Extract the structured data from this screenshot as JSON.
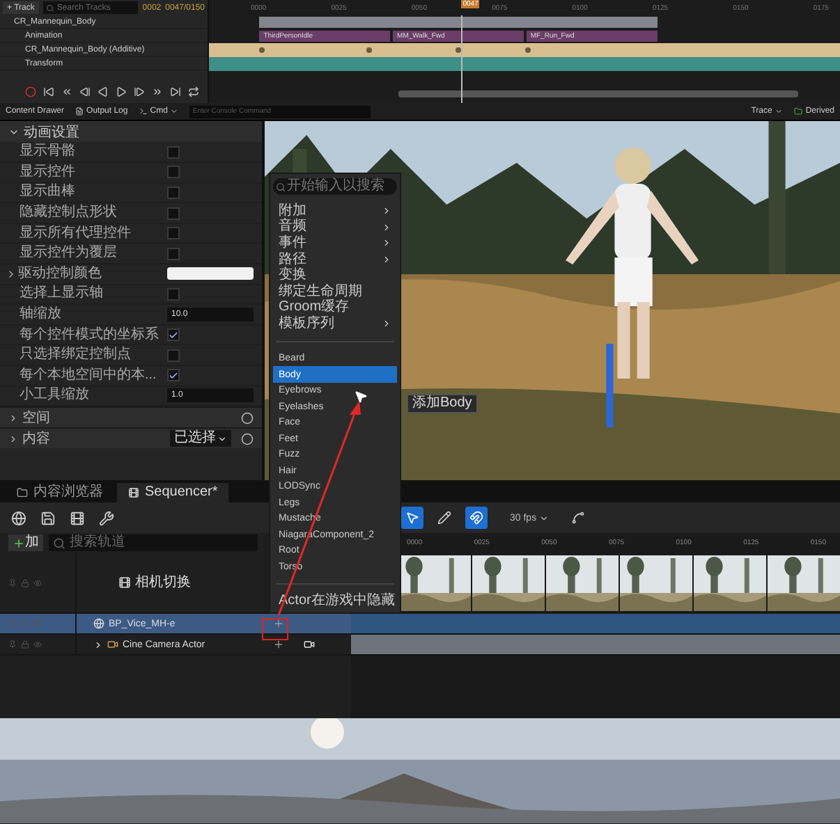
{
  "top_sequencer": {
    "add_track": "+ Track",
    "search": {
      "placeholder": "Search Tracks"
    },
    "frame_start": "0002",
    "frame_end": "0047/0150",
    "tracks": [
      {
        "label": "CR_Mannequin_Body",
        "children": [
          {
            "label": "Animation"
          },
          {
            "label": "CR_Mannequin_Body (Additive)"
          },
          {
            "label": "Transform"
          }
        ]
      }
    ],
    "ticks": [
      "0000",
      "0025",
      "0050",
      "0075",
      "0100",
      "0125",
      "0150",
      "0175"
    ],
    "playhead": "0047",
    "sections": [
      "ThirdPersonIdle",
      "MM_Walk_Fwd",
      "MF_Run_Fwd"
    ]
  },
  "bottom_bar": {
    "tabs": [
      "Content Drawer",
      "Output Log"
    ],
    "cmd": "Cmd",
    "cmd_placeholder": "Enter Console Command",
    "trace": "Trace",
    "derived": "Derived"
  },
  "details": {
    "section": "动画设置",
    "rows": [
      {
        "kind": "checkbox",
        "label": "显示骨骼",
        "checked": false
      },
      {
        "kind": "checkbox",
        "label": "显示控件",
        "checked": false
      },
      {
        "kind": "checkbox",
        "label": "显示曲棒",
        "checked": false
      },
      {
        "kind": "checkbox",
        "label": "隐藏控制点形状",
        "checked": false
      },
      {
        "kind": "checkbox",
        "label": "显示所有代理控件",
        "checked": false
      },
      {
        "kind": "checkbox",
        "label": "显示控件为覆层",
        "checked": false
      },
      {
        "kind": "color",
        "label": "驱动控制颜色",
        "expanded": false
      },
      {
        "kind": "checkbox",
        "label": "选择上显示轴",
        "checked": false
      },
      {
        "kind": "number",
        "label": "轴缩放",
        "value": "10.0"
      },
      {
        "kind": "checkbox",
        "label": "每个控件模式的坐标系",
        "checked": true
      },
      {
        "kind": "checkbox",
        "label": "只选择绑定控制点",
        "checked": false
      },
      {
        "kind": "checkbox",
        "label": "每个本地空间中的本...",
        "checked": true
      },
      {
        "kind": "number",
        "label": "小工具缩放",
        "value": "1.0"
      }
    ],
    "groups": [
      {
        "label": "空间"
      },
      {
        "label": "内容",
        "value": "已选择"
      }
    ]
  },
  "context_menu": {
    "search": {
      "placeholder": "开始输入以搜索"
    },
    "items": [
      {
        "kind": "submenu",
        "label": "附加",
        "selected": false
      },
      {
        "kind": "submenu",
        "label": "音频",
        "selected": false
      },
      {
        "kind": "submenu",
        "label": "事件",
        "selected": false
      },
      {
        "kind": "submenu",
        "label": "路径",
        "selected": false
      },
      {
        "kind": "action",
        "label": "变换",
        "selected": false
      },
      {
        "kind": "action",
        "label": "绑定生命周期",
        "selected": false
      },
      {
        "kind": "action",
        "label": "Groom缓存",
        "selected": false
      },
      {
        "kind": "submenu",
        "label": "模板序列",
        "selected": false
      },
      {
        "kind": "divider"
      },
      {
        "kind": "action",
        "label": "Beard",
        "selected": false
      },
      {
        "kind": "action",
        "label": "Body",
        "selected": true
      },
      {
        "kind": "action",
        "label": "Eyebrows",
        "selected": false
      },
      {
        "kind": "action",
        "label": "Eyelashes",
        "selected": false
      },
      {
        "kind": "action",
        "label": "Face",
        "selected": false
      },
      {
        "kind": "action",
        "label": "Feet",
        "selected": false
      },
      {
        "kind": "action",
        "label": "Fuzz",
        "selected": false
      },
      {
        "kind": "action",
        "label": "Hair",
        "selected": false
      },
      {
        "kind": "action",
        "label": "LODSync",
        "selected": false
      },
      {
        "kind": "action",
        "label": "Legs",
        "selected": false
      },
      {
        "kind": "action",
        "label": "Mustache",
        "selected": false
      },
      {
        "kind": "action",
        "label": "NiagaraComponent_2",
        "selected": false
      },
      {
        "kind": "action",
        "label": "Root",
        "selected": false
      },
      {
        "kind": "action",
        "label": "Torso",
        "selected": false
      },
      {
        "kind": "divider"
      },
      {
        "kind": "action",
        "label": "Actor在游戏中隐藏",
        "selected": false
      }
    ],
    "tooltip": "添加Body"
  },
  "sequencer": {
    "tabs": [
      {
        "label": "内容浏览器",
        "selected": false
      },
      {
        "label": "Sequencer*",
        "selected": true
      }
    ],
    "add": "加",
    "search": {
      "placeholder": "搜索轨道"
    },
    "fps": "30 fps",
    "ticks": [
      "0000",
      "0025",
      "0050",
      "0075",
      "0100",
      "0125",
      "0150"
    ],
    "tracks": [
      {
        "kind": "camera_cut",
        "label": "相机切换",
        "selected": false
      },
      {
        "kind": "actor",
        "label": "BP_Vice_MH-e",
        "selected": true
      },
      {
        "kind": "camera",
        "label": "Cine Camera Actor",
        "selected": false
      }
    ]
  }
}
